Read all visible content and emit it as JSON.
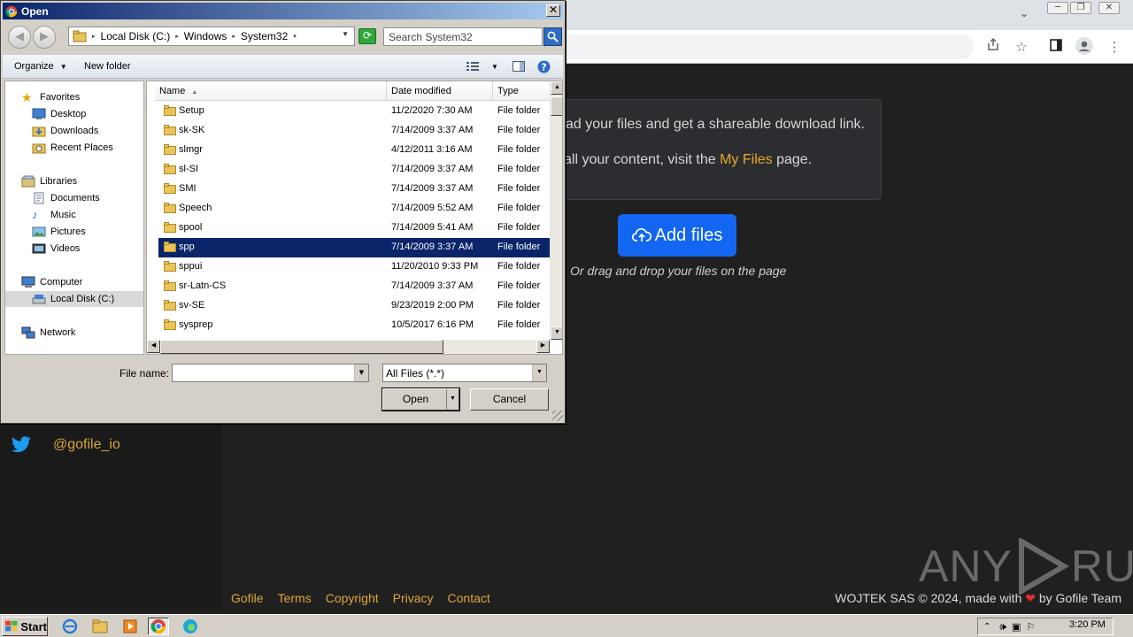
{
  "browser": {
    "window_min": "─",
    "window_restore": "❐",
    "window_close": "✕"
  },
  "site": {
    "twitter_handle": "@gofile_io",
    "info_line1": "ad your files and get a shareable download link.",
    "info_line2_pre": "all your content, visit the ",
    "info_line2_link": "My Files",
    "info_line2_post": " page.",
    "add_files_label": "Add files",
    "drag_hint": "Or drag and drop your files on the page",
    "footer_links": [
      "Gofile",
      "Terms",
      "Copyright",
      "Privacy",
      "Contact"
    ],
    "footer_right_pre": "WOJTEK SAS © 2024, made with",
    "footer_right_post": "by Gofile Team",
    "accent_color": "#1266f1",
    "link_color": "#e0a43a"
  },
  "watermark": {
    "left": "ANY",
    "right": "RUN"
  },
  "dialog": {
    "title": "Open",
    "breadcrumb": [
      "Local Disk (C:)",
      "Windows",
      "System32"
    ],
    "search_placeholder": "Search System32",
    "organize_label": "Organize",
    "new_folder_label": "New folder",
    "nav": {
      "favorites": "Favorites",
      "desktop": "Desktop",
      "downloads": "Downloads",
      "recent_places": "Recent Places",
      "libraries": "Libraries",
      "documents": "Documents",
      "music": "Music",
      "pictures": "Pictures",
      "videos": "Videos",
      "computer": "Computer",
      "local_disk": "Local Disk (C:)",
      "network": "Network"
    },
    "columns": [
      "Name",
      "Date modified",
      "Type"
    ],
    "files": [
      {
        "name": "Setup",
        "date": "11/2/2020 7:30 AM",
        "type": "File folder"
      },
      {
        "name": "sk-SK",
        "date": "7/14/2009 3:37 AM",
        "type": "File folder"
      },
      {
        "name": "slmgr",
        "date": "4/12/2011 3:16 AM",
        "type": "File folder"
      },
      {
        "name": "sl-SI",
        "date": "7/14/2009 3:37 AM",
        "type": "File folder"
      },
      {
        "name": "SMI",
        "date": "7/14/2009 3:37 AM",
        "type": "File folder"
      },
      {
        "name": "Speech",
        "date": "7/14/2009 5:52 AM",
        "type": "File folder"
      },
      {
        "name": "spool",
        "date": "7/14/2009 5:41 AM",
        "type": "File folder"
      },
      {
        "name": "spp",
        "date": "7/14/2009 3:37 AM",
        "type": "File folder",
        "selected": true
      },
      {
        "name": "sppui",
        "date": "11/20/2010 9:33 PM",
        "type": "File folder"
      },
      {
        "name": "sr-Latn-CS",
        "date": "7/14/2009 3:37 AM",
        "type": "File folder"
      },
      {
        "name": "sv-SE",
        "date": "9/23/2019 2:00 PM",
        "type": "File folder"
      },
      {
        "name": "sysprep",
        "date": "10/5/2017 6:16 PM",
        "type": "File folder"
      }
    ],
    "file_name_label": "File name:",
    "file_name_value": "",
    "file_type_value": "All Files (*.*)",
    "open_label": "Open",
    "cancel_label": "Cancel"
  },
  "taskbar": {
    "start_label": "Start",
    "clock": "3:20 PM"
  }
}
